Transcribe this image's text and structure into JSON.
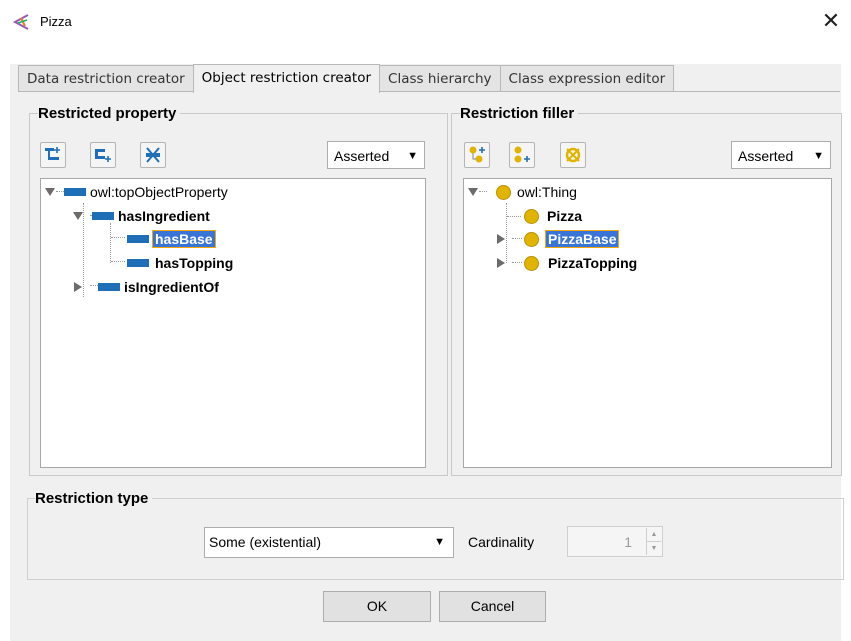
{
  "window": {
    "title": "Pizza",
    "close_glyph": "✕"
  },
  "tabs": [
    {
      "label": "Data restriction creator",
      "active": false
    },
    {
      "label": "Object restriction creator",
      "active": true
    },
    {
      "label": "Class hierarchy",
      "active": false
    },
    {
      "label": "Class expression editor",
      "active": false
    }
  ],
  "left_panel": {
    "title": "Restricted property",
    "view_mode": "Asserted",
    "toolbar_icons": [
      "add-sub-property-icon",
      "add-sibling-property-icon",
      "delete-property-icon"
    ],
    "tree": [
      {
        "label": "owl:topObjectProperty",
        "bold": false,
        "selected": false,
        "expander": "down"
      },
      {
        "label": "hasIngredient",
        "bold": true,
        "selected": false,
        "expander": "down"
      },
      {
        "label": "hasBase",
        "bold": true,
        "selected": true,
        "expander": "none"
      },
      {
        "label": "hasTopping",
        "bold": true,
        "selected": false,
        "expander": "none"
      },
      {
        "label": "isIngredientOf",
        "bold": true,
        "selected": false,
        "expander": "right"
      }
    ]
  },
  "right_panel": {
    "title": "Restriction filler",
    "view_mode": "Asserted",
    "toolbar_icons": [
      "add-subclass-icon",
      "add-sibling-class-icon",
      "delete-class-icon"
    ],
    "tree": [
      {
        "label": "owl:Thing",
        "bold": false,
        "selected": false,
        "expander": "down"
      },
      {
        "label": "Pizza",
        "bold": true,
        "selected": false,
        "expander": "none"
      },
      {
        "label": "PizzaBase",
        "bold": true,
        "selected": true,
        "expander": "right"
      },
      {
        "label": "PizzaTopping",
        "bold": true,
        "selected": false,
        "expander": "right"
      }
    ]
  },
  "restriction_type": {
    "title": "Restriction type",
    "selected": "Some (existential)",
    "cardinality_label": "Cardinality",
    "cardinality_value": "1"
  },
  "buttons": {
    "ok": "OK",
    "cancel": "Cancel"
  },
  "colors": {
    "selection": "#3875d7",
    "property_icon": "#1f6fb8",
    "class_icon": "#e0b400",
    "toolbar_icon_blue": "#1f6fb8"
  }
}
